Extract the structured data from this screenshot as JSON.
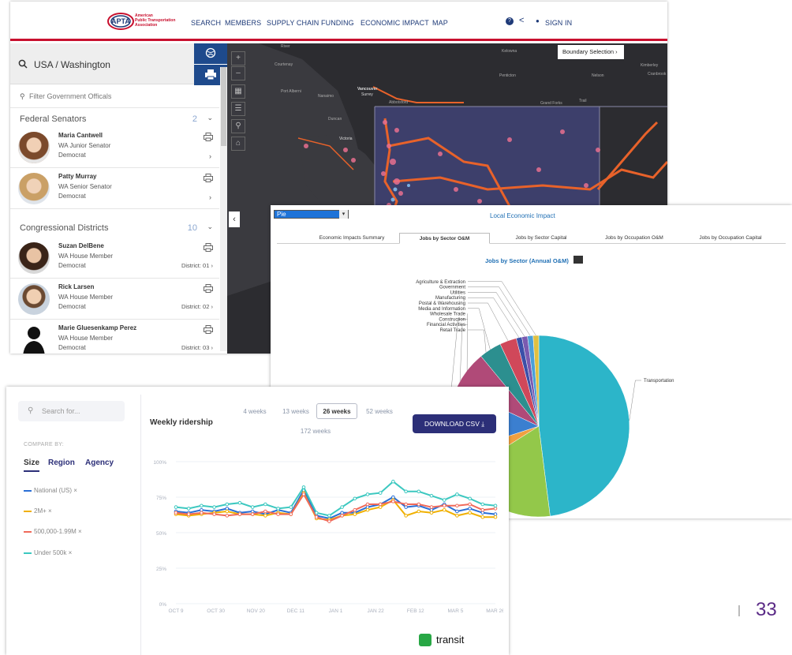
{
  "window1": {
    "logo": {
      "name_line1": "American",
      "name_line2": "Public Transportation",
      "name_line3": "Association",
      "mark": "APTA"
    },
    "nav": [
      "SEARCH",
      "MEMBERS",
      "SUPPLY CHAIN",
      "FUNDING",
      "ECONOMIC IMPACT",
      "MAP"
    ],
    "sign_in": "SIGN IN",
    "search_value": "USA / Washington",
    "filter_placeholder": "Filter Government Officals",
    "federal": {
      "title": "Federal Senators",
      "count": "2"
    },
    "senators": [
      {
        "name": "Maria Cantwell",
        "role": "WA Junior Senator",
        "party": "Democrat"
      },
      {
        "name": "Patty Murray",
        "role": "WA Senior Senator",
        "party": "Democrat"
      }
    ],
    "congress": {
      "title": "Congressional Districts",
      "count": "10"
    },
    "reps": [
      {
        "name": "Suzan DelBene",
        "role": "WA House Member",
        "party": "Democrat",
        "district": "District: 01"
      },
      {
        "name": "Rick Larsen",
        "role": "WA House Member",
        "party": "Democrat",
        "district": "District: 02"
      },
      {
        "name": "Marie Gluesenkamp Perez",
        "role": "WA House Member",
        "party": "Democrat",
        "district": "District: 03"
      }
    ],
    "boundary_button": "Boundary Selection",
    "map_labels": [
      "Courtenay",
      "Port Alberni",
      "Nanaimo",
      "Vancouver",
      "Surrey",
      "Abbotsford",
      "Duncan",
      "Victoria",
      "Kelowna",
      "Penticton",
      "Nelson",
      "Grand Forks",
      "Trail",
      "Kimberley",
      "Cranbrook",
      "River"
    ],
    "colors": {
      "accent_red": "#c8102e",
      "nav_blue": "#1e3a78",
      "side_button": "#1e4a8c",
      "map_bg": "#2c2c30",
      "route": "#e8622a"
    }
  },
  "window2": {
    "select_value": "Pie",
    "title": "Local Economic Impact",
    "tabs": [
      "Economic Impacts Summary",
      "Jobs by Sector O&M",
      "Jobs by Sector Capital",
      "Jobs by Occupation O&M",
      "Jobs by Occupation Capital"
    ],
    "active_tab": "Jobs by Sector O&M",
    "chart_title": "Jobs by Sector (Annual O&M)"
  },
  "window3": {
    "search_placeholder": "Search for...",
    "compare_by": "COMPARE BY:",
    "compare_options": [
      "Size",
      "Region",
      "Agency"
    ],
    "chart_title": "Weekly ridership",
    "week_buttons": [
      "4 weeks",
      "13 weeks",
      "26 weeks",
      "52 weeks",
      "172 weeks"
    ],
    "active_week": "26 weeks",
    "download": "DOWNLOAD CSV ⤓",
    "brand": "transit"
  },
  "page_number": "33",
  "chart_data": [
    {
      "type": "pie",
      "title": "Jobs by Sector (Annual O&M)",
      "labels": [
        "Transportation",
        "Retail Trade",
        "Financial Activities",
        "Construction",
        "Wholesale Trade",
        "Media and Information",
        "Postal & Warehousing",
        "Manufacturing",
        "Utilities",
        "Government",
        "Agriculture & Extraction"
      ],
      "values": [
        48,
        18,
        4,
        12,
        7,
        4,
        3,
        1,
        1,
        1,
        1
      ],
      "colors": [
        "#2cb5c9",
        "#93c84a",
        "#f0a040",
        "#3b7fd0",
        "#b04a78",
        "#2c8f8f",
        "#d0485a",
        "#3b4fa8",
        "#7a5ab0",
        "#4aa0d8",
        "#e0c040"
      ]
    },
    {
      "type": "line",
      "title": "Weekly ridership",
      "x_ticks": [
        "OCT 9",
        "OCT 30",
        "NOV 20",
        "DEC 11",
        "JAN 1",
        "JAN 22",
        "FEB 12",
        "MAR 5",
        "MAR 26"
      ],
      "y_ticks": [
        "0%",
        "25%",
        "50%",
        "75%",
        "100%"
      ],
      "ylim": [
        0,
        100
      ],
      "series": [
        {
          "name": "National (US)",
          "color": "#2a6fd6",
          "values": [
            65,
            64,
            66,
            65,
            67,
            64,
            65,
            63,
            66,
            64,
            80,
            62,
            60,
            64,
            64,
            68,
            70,
            75,
            68,
            69,
            66,
            70,
            65,
            67,
            64,
            63
          ]
        },
        {
          "name": "2M+",
          "color": "#f0b000",
          "values": [
            63,
            62,
            63,
            64,
            65,
            63,
            63,
            62,
            64,
            63,
            78,
            60,
            59,
            62,
            63,
            66,
            68,
            73,
            62,
            65,
            64,
            66,
            62,
            64,
            61,
            61
          ]
        },
        {
          "name": "500,000-1.99M",
          "color": "#f06a5a",
          "values": [
            64,
            63,
            64,
            63,
            62,
            63,
            63,
            65,
            63,
            63,
            77,
            61,
            58,
            62,
            66,
            70,
            70,
            72,
            70,
            70,
            68,
            69,
            69,
            70,
            66,
            67
          ]
        },
        {
          "name": "Under 500k",
          "color": "#3cc8c0",
          "values": [
            68,
            67,
            69,
            68,
            70,
            71,
            68,
            70,
            67,
            68,
            82,
            64,
            62,
            68,
            74,
            77,
            78,
            86,
            79,
            79,
            76,
            73,
            77,
            74,
            70,
            69
          ]
        }
      ]
    }
  ]
}
